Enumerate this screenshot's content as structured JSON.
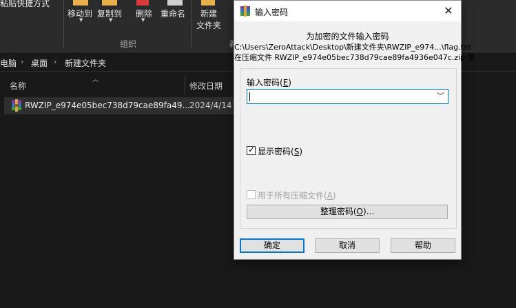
{
  "ribbon": {
    "paste_shortcut": "粘贴快捷方式",
    "move_to": "移动到",
    "copy_to": "复制到",
    "delete": "删除",
    "rename": "重命名",
    "new_folder_line1": "新建",
    "new_folder_line2": "文件夹",
    "group_organize": "组织",
    "group_new_partial": "新"
  },
  "breadcrumb": {
    "items": [
      "电脑",
      "桌面",
      "新建文件夹"
    ],
    "separator": "›"
  },
  "columns": {
    "name": "名称",
    "date": "修改日期"
  },
  "files": [
    {
      "name": "RWZIP_e974e05bec738d79cae89fa49...",
      "date": "2024/4/14"
    }
  ],
  "dialog": {
    "title": "输入密码",
    "close": "✕",
    "info_line1": "为加密的文件输入密码",
    "info_line2": "C:\\Users\\ZeroAttack\\Desktop\\新建文件夹\\RWZIP_e974...\\flag.txt",
    "info_line3": "在压缩文件 RWZIP_e974e05bec738d79cae89fa4936e047c.zip 里",
    "password_label": "输入密码",
    "password_key": "E",
    "password_value": "",
    "show_password_label": "显示密码",
    "show_password_key": "S",
    "show_password_checked": true,
    "use_all_label": "用于所有压缩文件",
    "use_all_key": "A",
    "use_all_checked": false,
    "organize_label": "整理密码",
    "organize_key": "O",
    "organize_suffix": "...",
    "ok": "确定",
    "cancel": "取消",
    "help": "帮助"
  },
  "colors": {
    "explorer_bg": "#191919",
    "ribbon_bg": "#2b2b2b",
    "dialog_bg": "#f0f0f0",
    "accent": "#0078d7"
  }
}
